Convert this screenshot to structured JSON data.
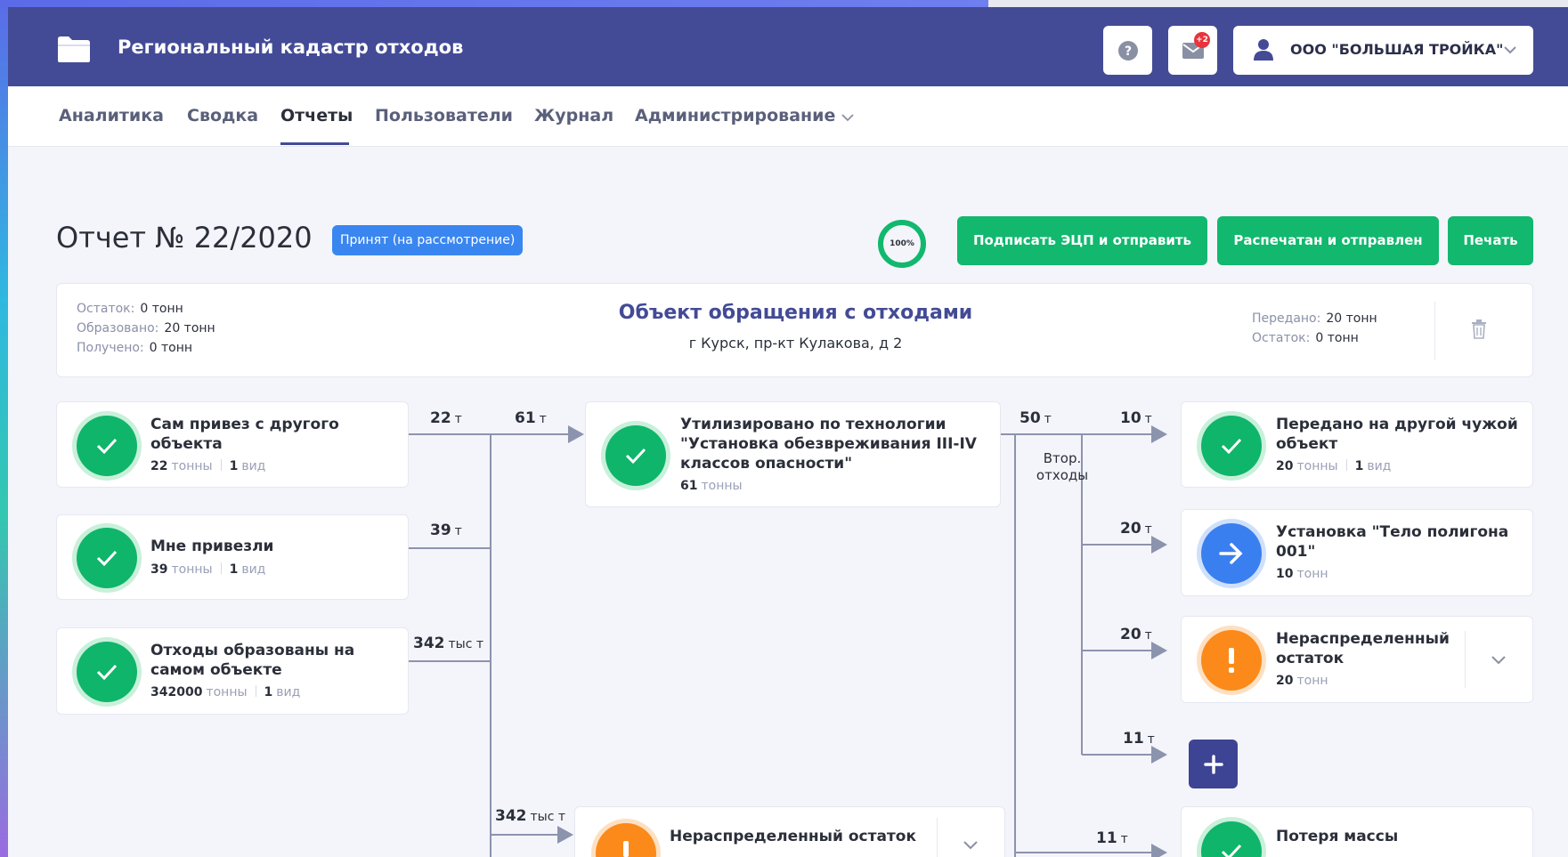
{
  "app": {
    "title": "Региональный кадастр отходов",
    "mail_badge": "+2",
    "org_name": "ООО \"БОЛЬШАЯ ТРОЙКА\""
  },
  "nav": {
    "items": [
      {
        "label": "Аналитика"
      },
      {
        "label": "Сводка"
      },
      {
        "label": "Отчеты",
        "active": true
      },
      {
        "label": "Пользователи"
      },
      {
        "label": "Журнал"
      },
      {
        "label": "Администрирование",
        "has_dropdown": true
      }
    ]
  },
  "report": {
    "title": "Отчет № 22/2020",
    "status": "Принят (на рассмотрение)",
    "progress_text": "100%",
    "progress_value": 1.0,
    "buttons": {
      "sign": "Подписать ЭЦП и отправить",
      "printed": "Распечатан и отправлен",
      "print": "Печать"
    }
  },
  "summary": {
    "left": [
      {
        "label": "Остаток:",
        "value": "0 тонн"
      },
      {
        "label": "Образовано:",
        "value": "20 тонн"
      },
      {
        "label": "Получено:",
        "value": "0 тонн"
      }
    ],
    "object_title": "Объект обращения с отходами",
    "object_address": "г Курск, пр-кт Кулакова, д 2",
    "right": [
      {
        "label": "Передано:",
        "value": "20 тонн"
      },
      {
        "label": "Остаток:",
        "value": "0 тонн"
      }
    ]
  },
  "inputs": [
    {
      "title": "Сам привез с другого объекта",
      "amount": "22",
      "unit": "тонны",
      "kinds": "1",
      "kinds_unit": "вид",
      "flow_label": "22",
      "flow_unit": "т"
    },
    {
      "title": "Мне привезли",
      "amount": "39",
      "unit": "тонны",
      "kinds": "1",
      "kinds_unit": "вид",
      "flow_label": "39",
      "flow_unit": "т"
    },
    {
      "title": "Отходы образованы на самом объекте",
      "amount": "342000",
      "unit": "тонны",
      "kinds": "1",
      "kinds_unit": "вид",
      "flow_label": "342",
      "flow_unit": "тыс т"
    }
  ],
  "middle": {
    "utilized": {
      "title": "Утилизировано по технологии \"Установка обезвреживания III-IV классов опасности\"",
      "amount": "61",
      "unit": "тонны",
      "flow_label": "61",
      "flow_unit": "т"
    },
    "unallocated": {
      "title": "Нераспределенный остаток",
      "flow_label": "342",
      "flow_unit": "тыс т"
    }
  },
  "secondary": {
    "flow_label": "50",
    "flow_unit": "т",
    "label": "Втор. отходы"
  },
  "outputs": [
    {
      "title": "Передано на другой чужой объект",
      "amount": "20",
      "unit": "тонны",
      "kinds": "1",
      "kinds_unit": "вид",
      "flow_label": "10",
      "flow_unit": "т",
      "icon": "check"
    },
    {
      "title": "Установка \"Тело полигона 001\"",
      "amount": "10",
      "unit": "тонн",
      "flow_label": "20",
      "flow_unit": "т",
      "icon": "arrow"
    },
    {
      "title": "Нераспределенный остаток",
      "amount": "20",
      "unit": "тонн",
      "flow_label": "20",
      "flow_unit": "т",
      "icon": "warning"
    },
    {
      "flow_label": "11",
      "flow_unit": "т",
      "add_label": "+"
    },
    {
      "title": "Потеря массы",
      "flow_label": "11",
      "flow_unit": "т",
      "icon": "check"
    }
  ]
}
